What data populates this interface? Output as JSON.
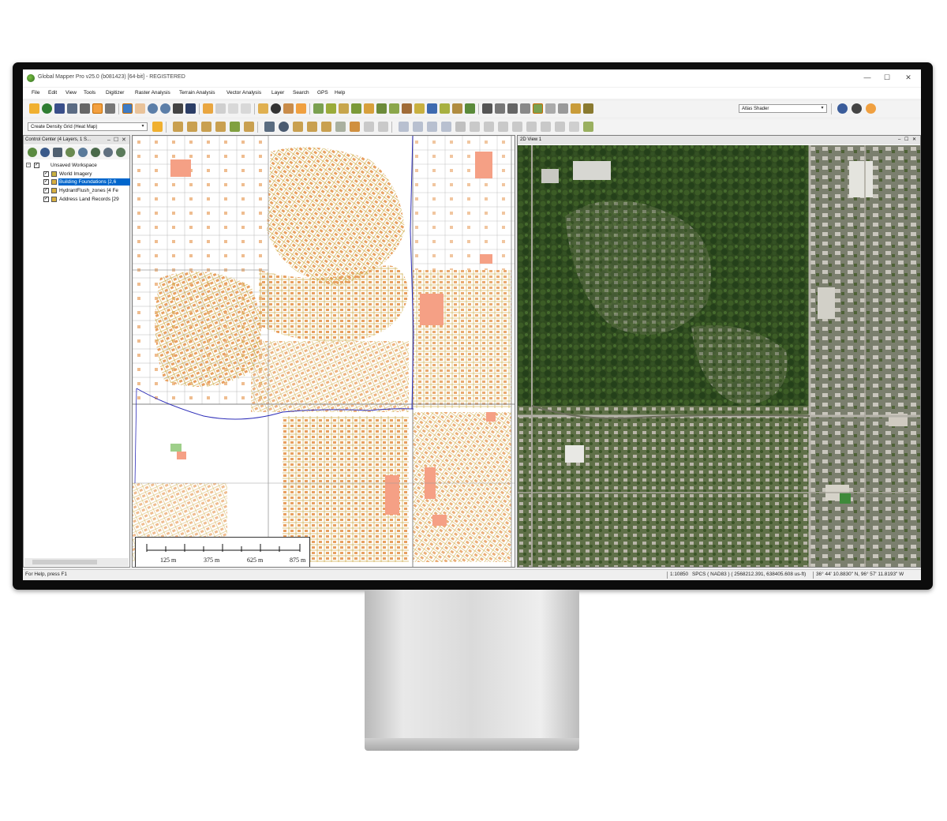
{
  "window": {
    "title": "Global Mapper Pro v25.0 (b081423) [64-bit] - REGISTERED",
    "minimize": "—",
    "maximize": "☐",
    "close": "✕"
  },
  "menu": [
    "File",
    "Edit",
    "View",
    "Tools",
    "Digitizer",
    "Raster Analysis",
    "Terrain Analysis",
    "Vector Analysis",
    "Layer",
    "Search",
    "GPS",
    "Help"
  ],
  "toolbar": {
    "shader_select": "Atlas Shader",
    "density_select": "Create Density Grid (Heat Map)"
  },
  "control_center": {
    "title": "Control Center (4 Layers, 1 S...",
    "minimize": "–",
    "restore": "☐",
    "close": "✕",
    "workspace": "Unsaved Workspace",
    "layers": [
      {
        "label": "World Imagery",
        "selected": false
      },
      {
        "label": "Building Foundations [2,6",
        "selected": true
      },
      {
        "label": "HydrantFlush_zones [4 Fe",
        "selected": false
      },
      {
        "label": "Address Land Records [29",
        "selected": false
      }
    ]
  },
  "view": {
    "title": "2D View 1",
    "minimize": "–",
    "restore": "☐",
    "close": "✕"
  },
  "scale_bar": {
    "labels": [
      "125 m",
      "375 m",
      "625 m",
      "875 m"
    ]
  },
  "status": {
    "help": "For Help, press F1",
    "scale": "1:10850",
    "projection": "SPCS ( NAD83 ) ( 2568212.391, 638405.608 us-ft)",
    "latlon": "36° 44' 10.8830\" N, 96° 57' 11.8193\" W"
  },
  "colors": {
    "building_fill": "#f5a085",
    "parcel_line": "#c8a02e",
    "road_line": "#9a9a9a",
    "water_line": "#2d2db8",
    "selection": "#0066cc",
    "imagery_forest": "#2c4a1c"
  }
}
